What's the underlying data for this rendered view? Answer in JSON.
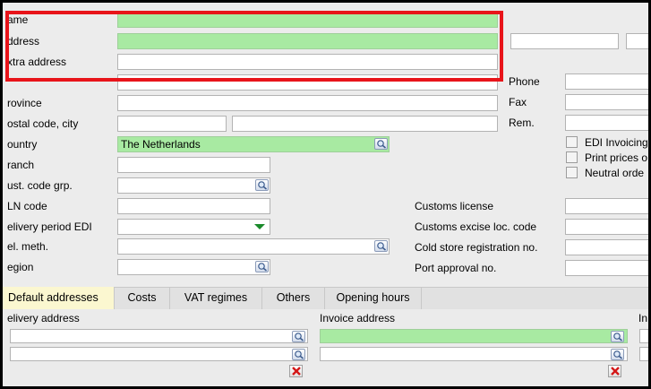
{
  "form": {
    "name_label": "ame",
    "address_label": "ddress",
    "extra_address_label": "xtra address",
    "phone_label": "Phone",
    "province_label": "rovince",
    "fax_label": "Fax",
    "postal_label": "ostal code, city",
    "rem_label": "Rem.",
    "country_label": "ountry",
    "country_value": "The Netherlands",
    "branch_label": "ranch",
    "cust_code_label": "ust. code grp.",
    "ln_code_label": "LN code",
    "delivery_period_label": "elivery period EDI",
    "del_meth_label": "el. meth.",
    "region_label": "egion"
  },
  "checkboxes": {
    "edi_invoicing": "EDI Invoicing",
    "print_prices": "Print prices o",
    "neutral_order": "Neutral orde"
  },
  "customs": {
    "license_label": "Customs license",
    "excise_label": "Customs excise loc. code",
    "cold_store_label": "Cold store registration no.",
    "port_approval_label": "Port approval no."
  },
  "tabs": [
    "Default addresses",
    "Costs",
    "VAT regimes",
    "Others",
    "Opening hours"
  ],
  "lower": {
    "delivery_address_label": "elivery address",
    "invoice_address_label": "Invoice address",
    "third_label": "In"
  },
  "colors": {
    "field_green": "#a8eaa2",
    "highlight_red": "#e8141a",
    "active_tab": "#fbf7d0"
  }
}
